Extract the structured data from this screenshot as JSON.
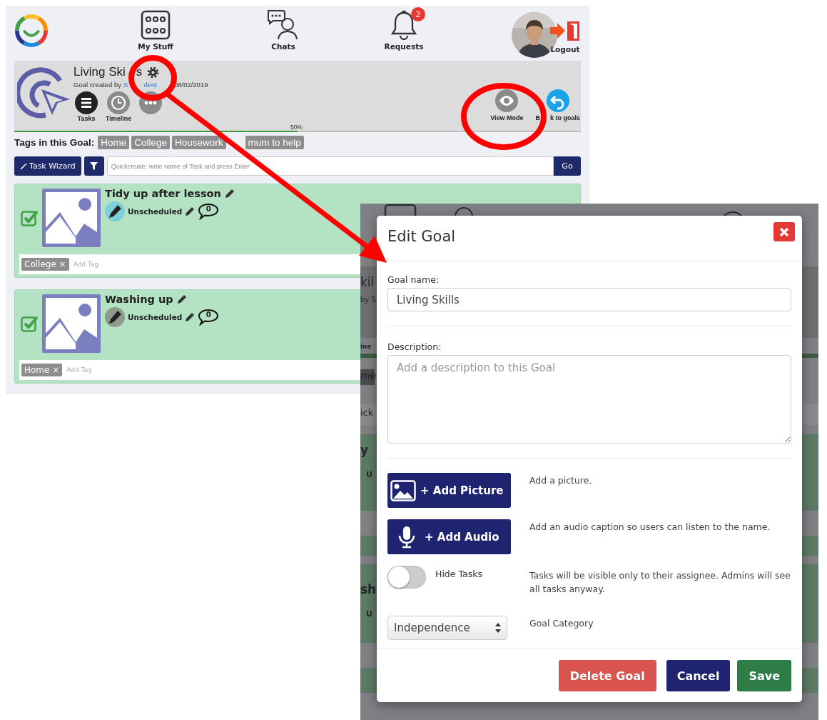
{
  "header": {
    "nav": [
      {
        "label": "My Stuff",
        "kind": "stuff"
      },
      {
        "label": "Chats",
        "kind": "chats"
      },
      {
        "label": "Requests",
        "kind": "requests",
        "badge": "2"
      }
    ],
    "logout": "Logout"
  },
  "goal": {
    "title_parts": [
      "Living Ski",
      "s"
    ],
    "created_prefix": "Goal created by",
    "author_parts": [
      "S",
      "dent"
    ],
    "date": "08/02/2019",
    "tabs": [
      {
        "label": "Tasks",
        "kind": "tasks",
        "selected": true
      },
      {
        "label": "Timeline",
        "kind": "timeline",
        "selected": false
      },
      {
        "kind": "more",
        "selected": false
      }
    ],
    "actions": [
      {
        "label_parts": [
          "View Mode"
        ],
        "kind": "view"
      },
      {
        "label_parts": [
          "B",
          "k to goals"
        ],
        "kind": "back"
      }
    ],
    "progress": {
      "level": 0.5,
      "reading": "50%"
    }
  },
  "tags": {
    "label": "Tags in this Goal:",
    "items": [
      "Home",
      "College",
      "Housework",
      "mum to help"
    ]
  },
  "toolbar": {
    "wizard": "Task Wizard",
    "search_placeholder": "Quickcreate: write name of Task and press Enter",
    "go": "Go"
  },
  "tasks": [
    {
      "title": "Tidy up after lesson",
      "checked": true,
      "color": "#7ccfd6",
      "schedule": "Unscheduled",
      "comments": "0",
      "tags": [
        {
          "label": "College",
          "remove": "×"
        }
      ],
      "tag_placeholder": "Add Tag"
    },
    {
      "title": "Washing up",
      "checked": true,
      "color": "#8e9a8c",
      "schedule": "Unscheduled",
      "comments": "0",
      "tags": [
        {
          "label": "Home",
          "remove": "×"
        }
      ],
      "tag_placeholder": "Add Tag"
    }
  ],
  "background_fragments": [
    "kil",
    "by S",
    "ine",
    "me",
    "ick",
    "y",
    "U",
    "sh",
    "U"
  ],
  "dialog": {
    "title": "Edit Goal",
    "name_label": "Goal name:",
    "name_value": "Living Skills",
    "description_label": "Description:",
    "description_placeholder": "Add a description to this Goal",
    "rows": [
      {
        "kind": "button",
        "label": "+ Add Picture",
        "hint": "Add a picture."
      },
      {
        "kind": "button",
        "label": "+ Add Audio",
        "hint": "Add an audio caption so users can listen to the name."
      },
      {
        "kind": "toggle",
        "label": "Hide Tasks",
        "on": false,
        "hint": "Tasks will be visible only to their assignee. Admins will see all tasks anyway."
      },
      {
        "kind": "select",
        "value": "Independence",
        "hint": "Goal Category"
      }
    ],
    "buttons": [
      {
        "label": "Delete Goal",
        "kind": "danger"
      },
      {
        "label": "Cancel",
        "kind": "primary"
      },
      {
        "label": "Save",
        "kind": "success"
      }
    ]
  }
}
